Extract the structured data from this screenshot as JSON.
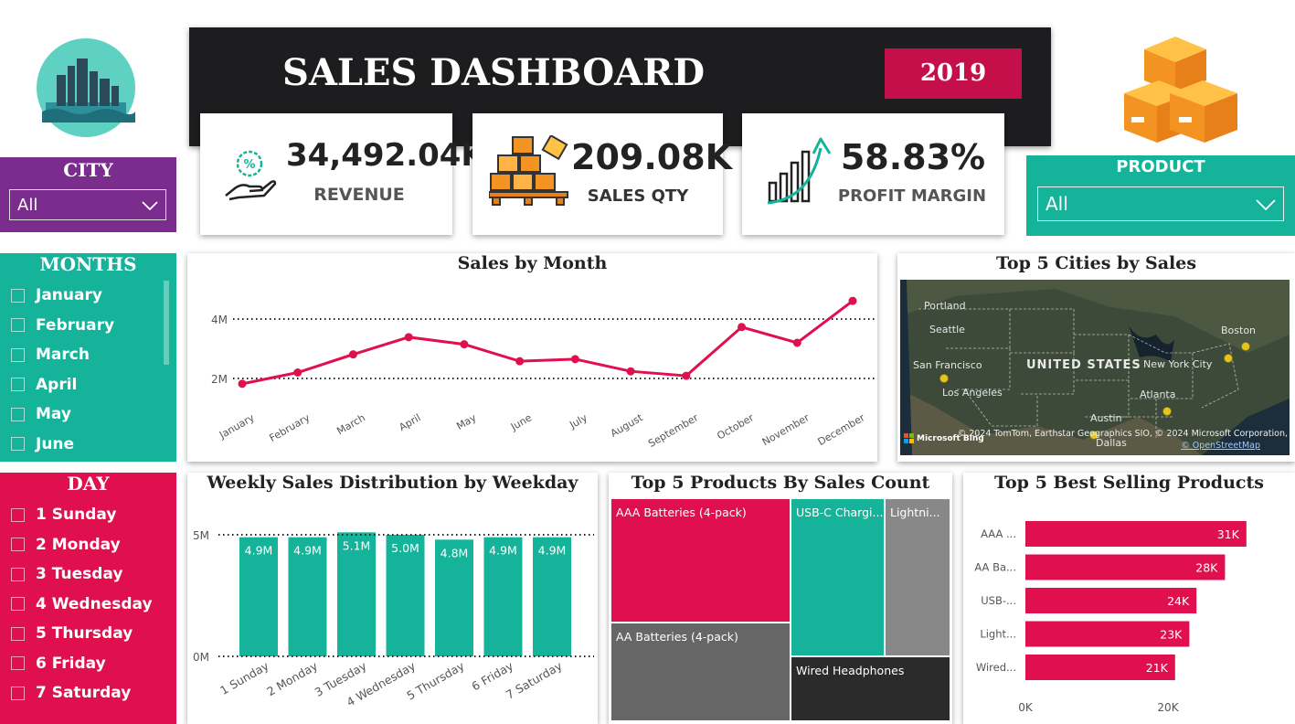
{
  "header": {
    "title": "SALES DASHBOARD",
    "year": "2019"
  },
  "kpis": {
    "revenue": {
      "value": "34,492.04K",
      "label": "REVENUE"
    },
    "sales_qty": {
      "value": "209.08K",
      "label": "SALES QTY"
    },
    "profit_margin": {
      "value": "58.83%",
      "label": "PROFIT MARGIN"
    }
  },
  "slicers": {
    "city": {
      "title": "CITY",
      "selected": "All"
    },
    "product": {
      "title": "PRODUCT",
      "selected": "All"
    },
    "months": {
      "title": "MONTHS",
      "items": [
        "January",
        "February",
        "March",
        "April",
        "May",
        "June"
      ]
    },
    "day": {
      "title": "DAY",
      "items": [
        "1 Sunday",
        "2 Monday",
        "3 Tuesday",
        "4 Wednesday",
        "5 Thursday",
        "6 Friday",
        "7 Saturday"
      ]
    }
  },
  "colors": {
    "accent": "#e0104f",
    "teal": "#14b39a",
    "purple": "#7b2d8e",
    "dark": "#1d1d1f"
  },
  "map": {
    "title": "Top 5 Cities by Sales",
    "country_label": "UNITED STATES",
    "cities": [
      "Portland",
      "Seattle",
      "San Francisco",
      "Los Angeles",
      "Boston",
      "New York City",
      "Atlanta",
      "Austin",
      "Dallas"
    ],
    "bing": "Microsoft Bing",
    "copyright": "© 2024 TomTom, Earthstar Geographics SIO, © 2024 Microsoft Corporation,",
    "osm": "© OpenStreetMap"
  },
  "chart_data": [
    {
      "type": "line",
      "title": "Sales by Month",
      "categories": [
        "January",
        "February",
        "March",
        "April",
        "May",
        "June",
        "July",
        "August",
        "September",
        "October",
        "November",
        "December"
      ],
      "values": [
        1.82,
        2.2,
        2.81,
        3.39,
        3.15,
        2.58,
        2.65,
        2.24,
        2.09,
        3.73,
        3.2,
        4.61
      ],
      "yticks": [
        "2M",
        "4M"
      ],
      "ylim": [
        2,
        4
      ],
      "color": "#e0104f"
    },
    {
      "type": "bar",
      "title": "Weekly Sales Distribution by Weekday",
      "categories": [
        "1 Sunday",
        "2 Monday",
        "3 Tuesday",
        "4 Wednesday",
        "5 Thursday",
        "6 Friday",
        "7 Saturday"
      ],
      "values": [
        4.9,
        4.9,
        5.1,
        5.0,
        4.8,
        4.9,
        4.9
      ],
      "labels": [
        "4.9M",
        "4.9M",
        "5.1M",
        "5.0M",
        "4.8M",
        "4.9M",
        "4.9M"
      ],
      "yticks": [
        "0M",
        "5M"
      ],
      "ylim": [
        0,
        5
      ],
      "color": "#14b39a"
    },
    {
      "type": "treemap",
      "title": "Top 5 Products By Sales Count",
      "items": [
        {
          "name": "AAA Batteries (4-pack)",
          "value": 31,
          "color": "#e0104f"
        },
        {
          "name": "AA Batteries (4-pack)",
          "value": 28,
          "color": "#666666"
        },
        {
          "name": "USB-C Chargi...",
          "value": 24,
          "color": "#14b39a"
        },
        {
          "name": "Lightni...",
          "value": 23,
          "color": "#888888"
        },
        {
          "name": "Wired Headphones",
          "value": 21,
          "color": "#2b2b2b"
        }
      ]
    },
    {
      "type": "bar",
      "orientation": "horizontal",
      "title": "Top 5 Best Selling Products",
      "categories": [
        "AAA ...",
        "AA Ba...",
        "USB-...",
        "Light...",
        "Wired..."
      ],
      "values": [
        31,
        28,
        24,
        23,
        21
      ],
      "labels": [
        "31K",
        "28K",
        "24K",
        "23K",
        "21K"
      ],
      "xticks": [
        "0K",
        "20K"
      ],
      "xlim": [
        0,
        20
      ],
      "color": "#e0104f"
    }
  ]
}
